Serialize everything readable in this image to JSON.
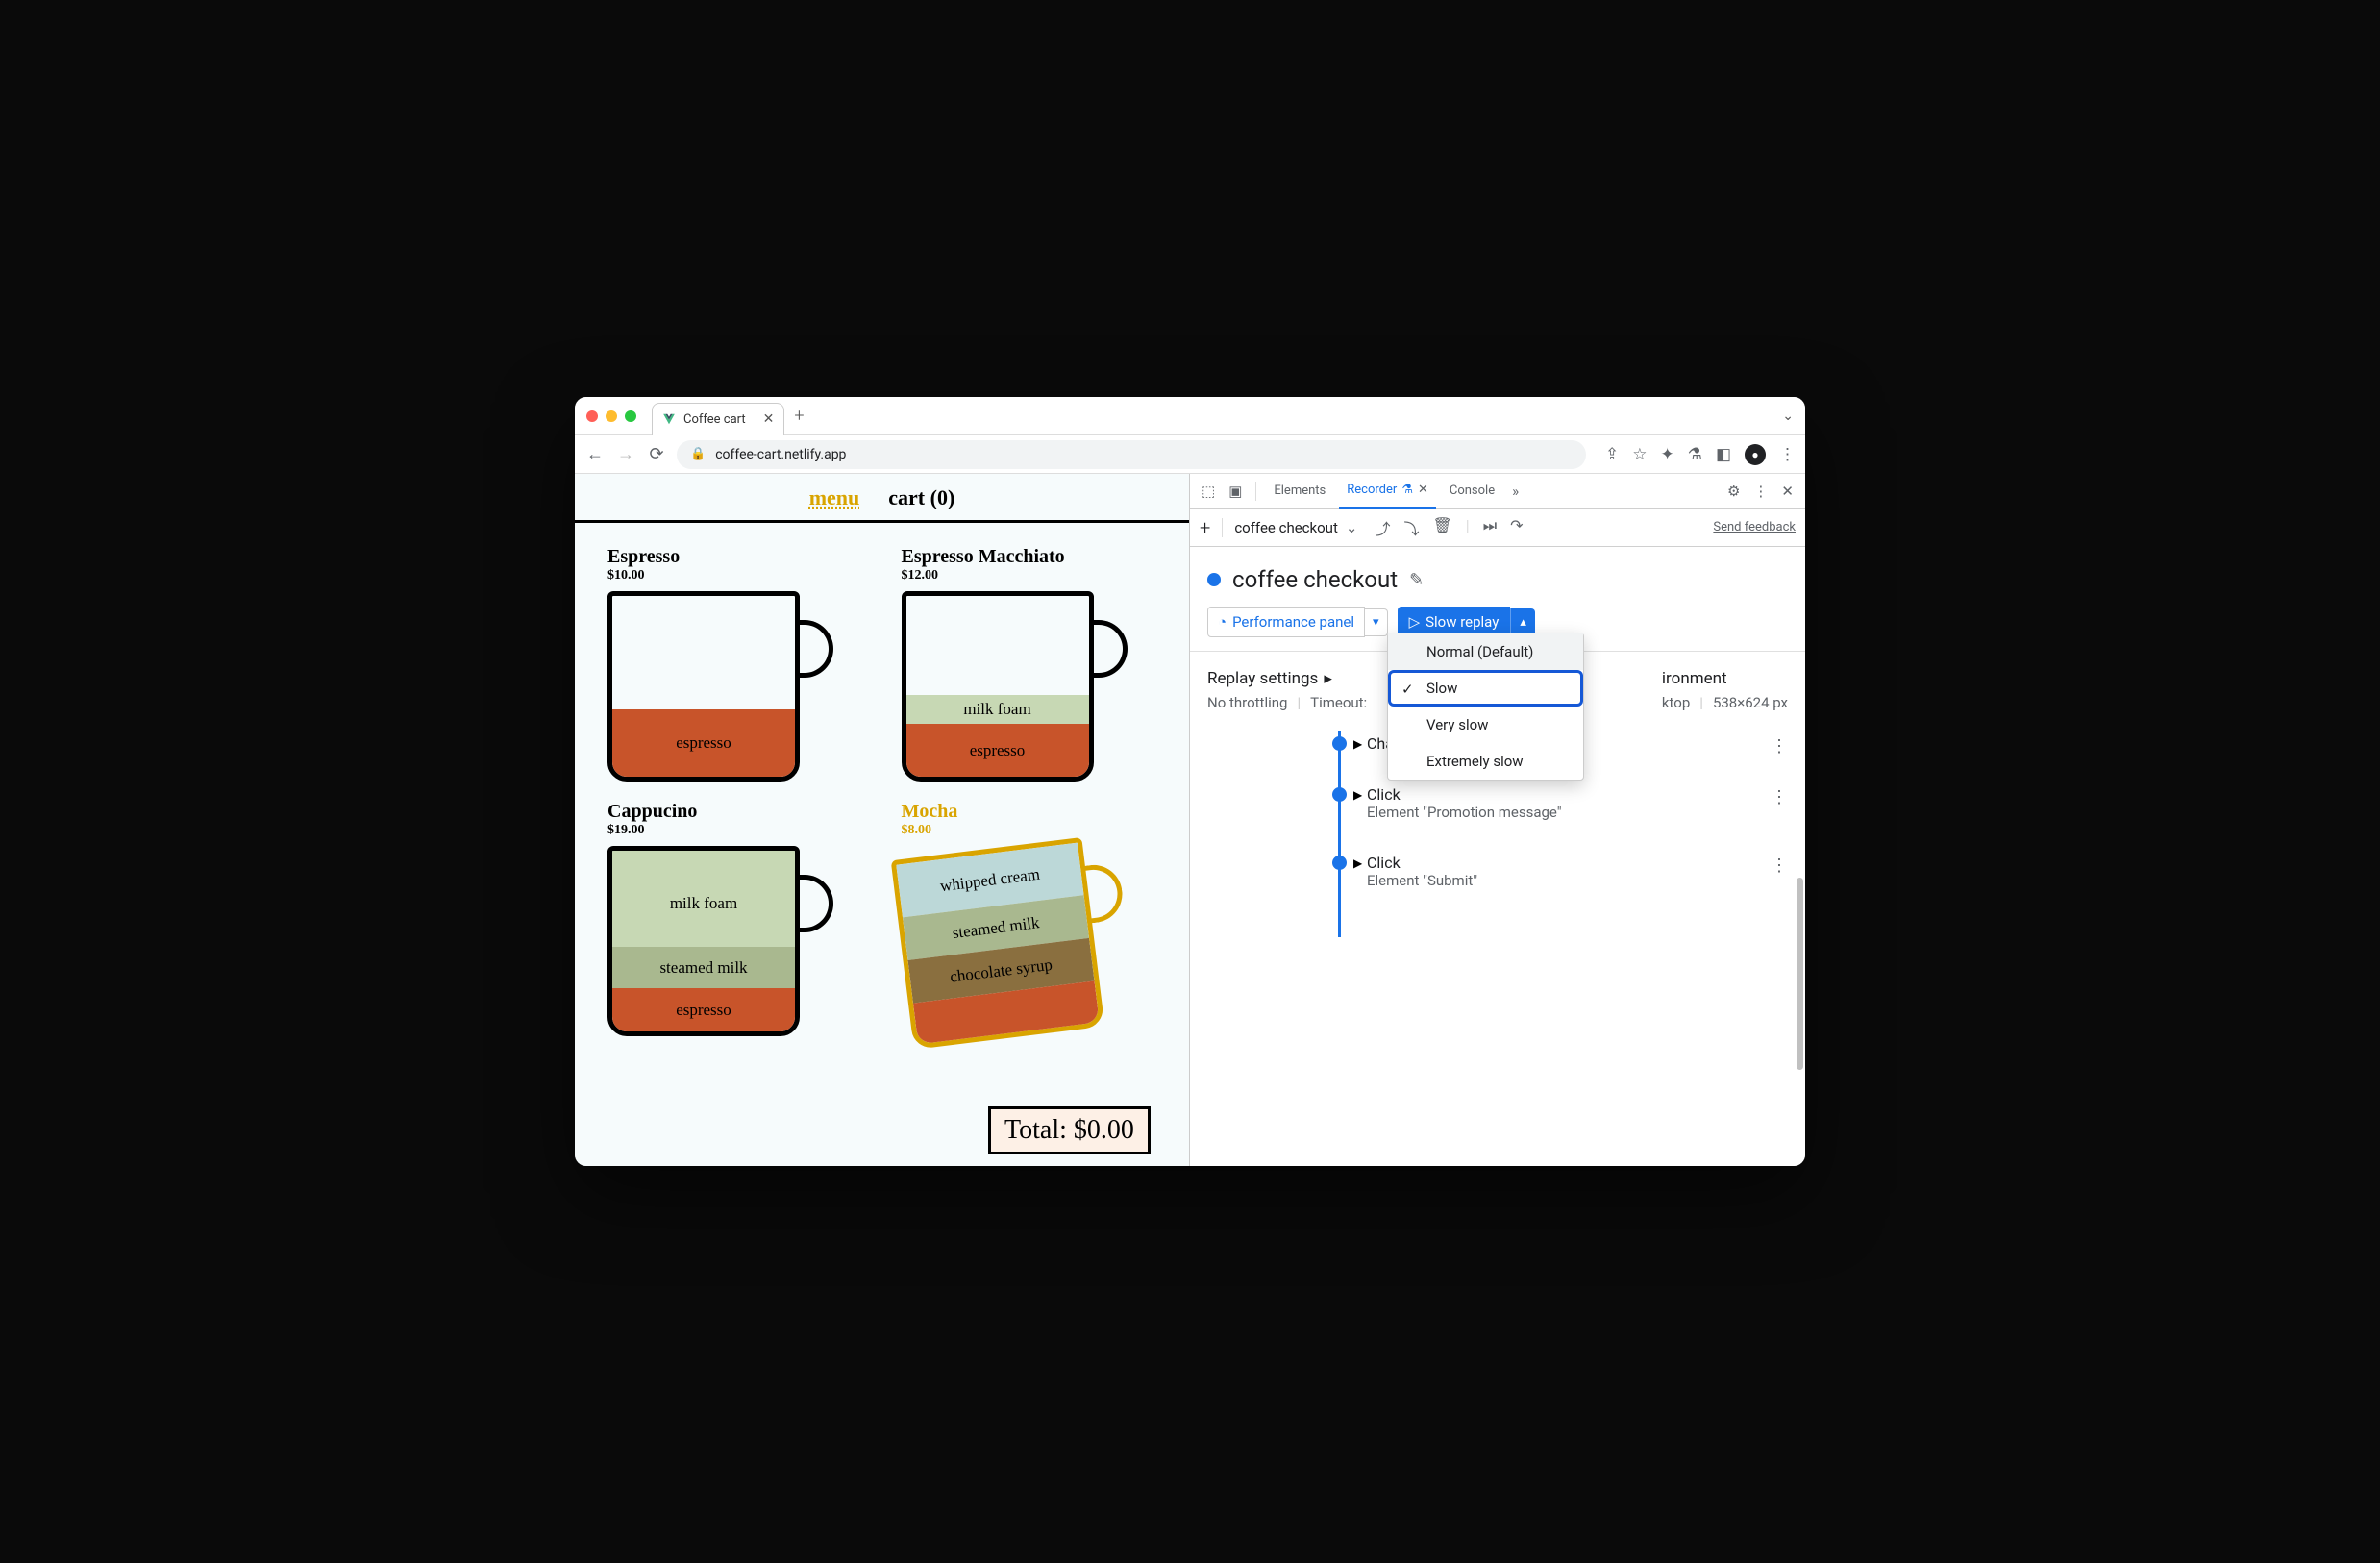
{
  "browser": {
    "tab_title": "Coffee cart",
    "url": "coffee-cart.netlify.app"
  },
  "page": {
    "nav": {
      "menu": "menu",
      "cart": "cart (0)"
    },
    "products": [
      {
        "name": "Espresso",
        "price": "$10.00",
        "layers": [
          "espresso"
        ]
      },
      {
        "name": "Espresso Macchiato",
        "price": "$12.00",
        "layers": [
          "milk foam",
          "espresso"
        ]
      },
      {
        "name": "Cappucino",
        "price": "$19.00",
        "layers": [
          "milk foam",
          "steamed milk",
          "espresso"
        ]
      },
      {
        "name": "Mocha",
        "price": "$8.00",
        "layers": [
          "whipped cream",
          "steamed milk",
          "chocolate syrup"
        ]
      }
    ],
    "total": "Total: $0.00"
  },
  "devtools": {
    "tabs": {
      "elements": "Elements",
      "recorder": "Recorder",
      "console": "Console"
    },
    "selector": "coffee checkout",
    "feedback": "Send feedback",
    "recording_title": "coffee checkout",
    "perf_button": "Performance panel",
    "slow_button": "Slow replay",
    "dropdown": [
      "Normal (Default)",
      "Slow",
      "Very slow",
      "Extremely slow"
    ],
    "settings_label": "Replay settings",
    "throttling": "No throttling",
    "timeout_label": "Timeout:",
    "env_label": "ironment",
    "env_sub1": "ktop",
    "env_sub2": "538×624 px",
    "steps": [
      {
        "title": "Change",
        "sub": ""
      },
      {
        "title": "Click",
        "sub": "Element \"Promotion message\""
      },
      {
        "title": "Click",
        "sub": "Element \"Submit\""
      }
    ]
  }
}
